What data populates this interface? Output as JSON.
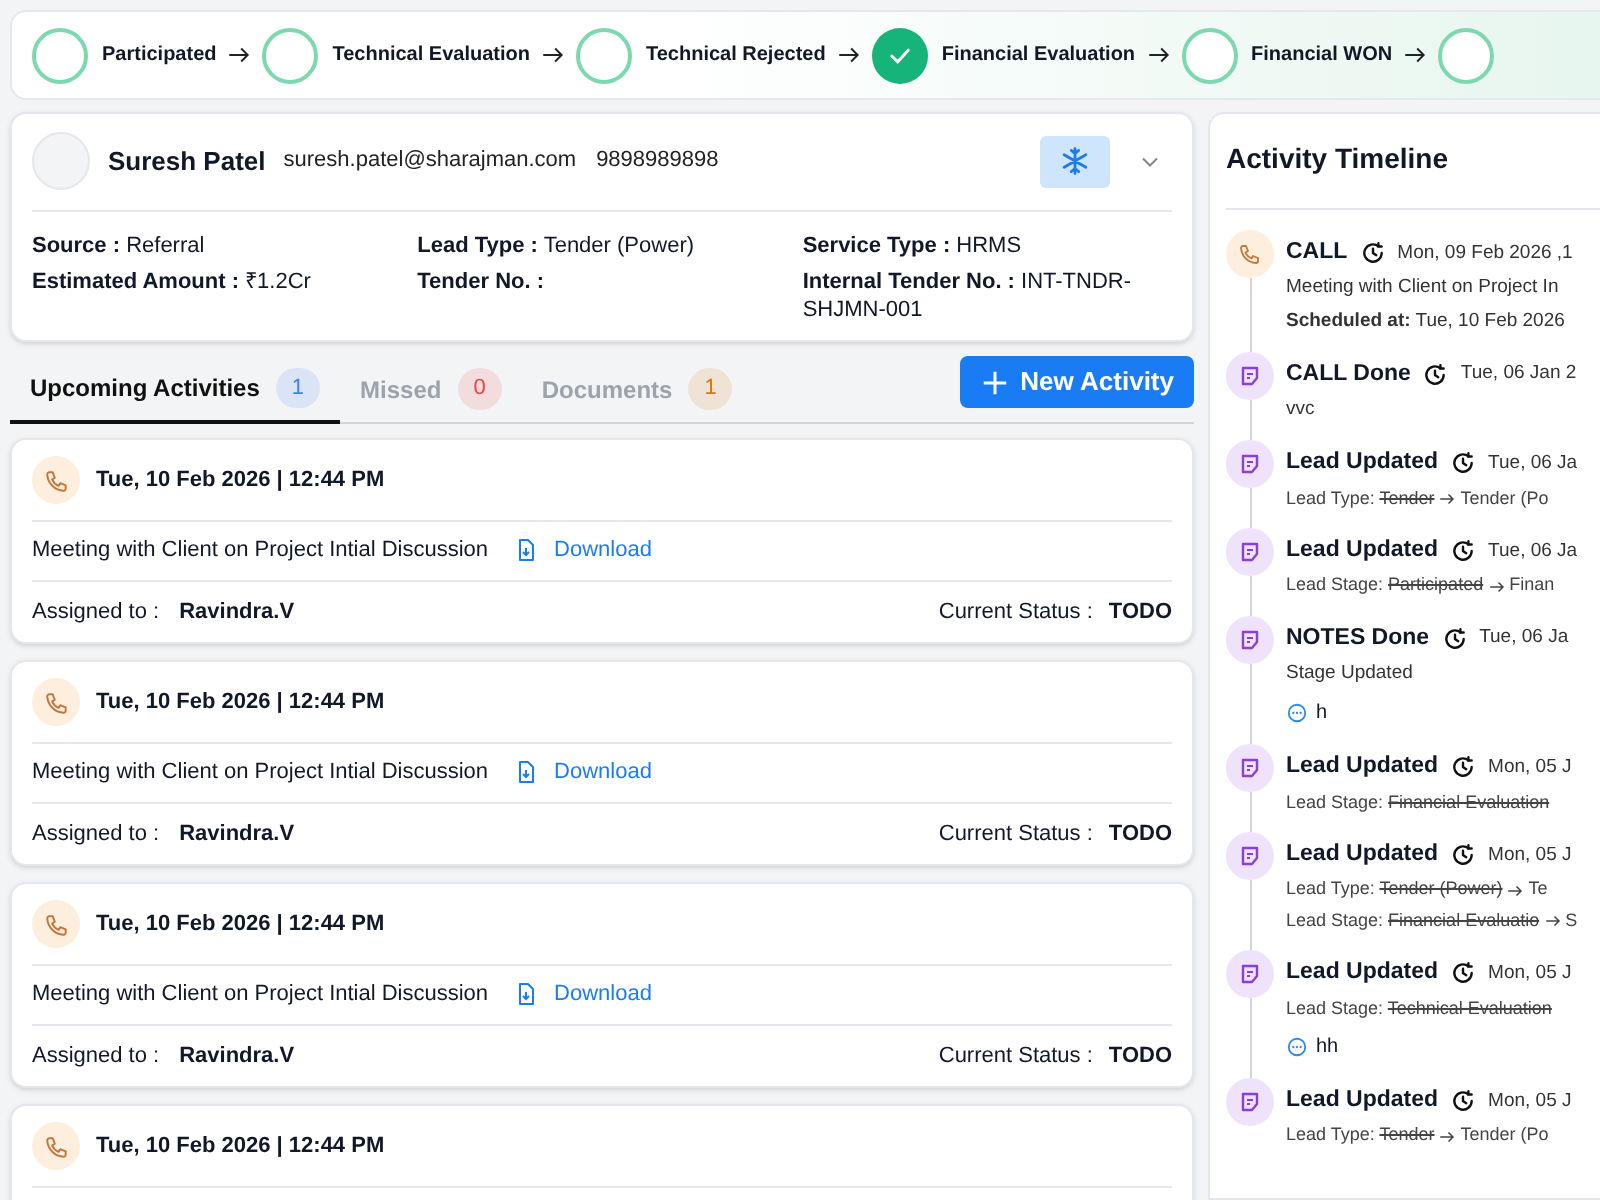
{
  "stages": [
    {
      "label": "Participated",
      "completed": false
    },
    {
      "label": "Technical Evaluation",
      "completed": false
    },
    {
      "label": "Technical Rejected",
      "completed": false
    },
    {
      "label": "Financial Evaluation",
      "completed": true
    },
    {
      "label": "Financial WON",
      "completed": false
    },
    {
      "completed": false
    }
  ],
  "lead": {
    "name": "Suresh Patel",
    "email": "suresh.patel@sharajman.com",
    "phone": "9898989898",
    "fields": [
      [
        {
          "label": "Source :",
          "value": "Referral"
        },
        {
          "label": "Estimated Amount :",
          "value": "₹1.2Cr"
        }
      ],
      [
        {
          "label": "Lead Type :",
          "value": "Tender (Power)"
        },
        {
          "label": "Tender No. :"
        }
      ],
      [
        {
          "label": "Service Type :",
          "value": "HRMS"
        },
        {
          "label": "Internal Tender No. :",
          "value": "INT-TNDR-SHJMN-001"
        }
      ]
    ]
  },
  "tabs": [
    {
      "label": "Upcoming Activities",
      "count": "1",
      "selected": true,
      "color": "#3b82f6"
    },
    {
      "label": "Missed",
      "count": "0",
      "selected": false,
      "color": "#ef4444"
    },
    {
      "label": "Documents",
      "count": "1",
      "selected": false,
      "color": "#d97706"
    }
  ],
  "new_activity_button": "New Activity",
  "activities": [
    {
      "datetime": "Tue, 10 Feb 2026 | 12:44 PM",
      "description": "Meeting with Client on Project Intial Discussion",
      "link": "Download",
      "assigned_label": "Assigned to :",
      "assigned": "Ravindra.V",
      "status_label": "Current Status :",
      "status": "TODO"
    },
    {
      "datetime": "Tue, 10 Feb 2026 | 12:44 PM",
      "description": "Meeting with Client on Project Intial Discussion",
      "link": "Download",
      "assigned_label": "Assigned to :",
      "assigned": "Ravindra.V",
      "status_label": "Current Status :",
      "status": "TODO"
    },
    {
      "datetime": "Tue, 10 Feb 2026 | 12:44 PM",
      "description": "Meeting with Client on Project Intial Discussion",
      "link": "Download",
      "assigned_label": "Assigned to :",
      "assigned": "Ravindra.V",
      "status_label": "Current Status :",
      "status": "TODO"
    },
    {
      "datetime": "Tue, 10 Feb 2026 | 12:44 PM"
    }
  ],
  "timeline": {
    "title": "Activity Timeline",
    "entries": [
      {
        "kind": "call",
        "title": "CALL",
        "time": "Mon, 09 Feb 2026 ,1",
        "lines": [
          "Meeting with Client on Project In",
          "**Scheduled at:** Tue, 10 Feb 2026"
        ]
      },
      {
        "kind": "note",
        "title": "CALL Done",
        "time": "Tue, 06 Jan 2",
        "lines": [
          "vvc"
        ]
      },
      {
        "kind": "note",
        "title": "Lead Updated",
        "time": "Tue, 06 Ja",
        "changes": [
          {
            "label": "Lead Type:",
            "old": "Tender",
            "new": "Tender (Po"
          }
        ]
      },
      {
        "kind": "note",
        "title": "Lead Updated",
        "time": "Tue, 06 Ja",
        "changes": [
          {
            "label": "Lead Stage:",
            "old": "Participated",
            "new": "Finan"
          }
        ]
      },
      {
        "kind": "note",
        "title": "NOTES Done",
        "time": "Tue, 06 Ja",
        "lines": [
          "Stage Updated"
        ],
        "comment": "h"
      },
      {
        "kind": "note",
        "title": "Lead Updated",
        "time": "Mon, 05 J",
        "changes": [
          {
            "label": "Lead Stage:",
            "old": "Financial Evaluation"
          }
        ]
      },
      {
        "kind": "note",
        "title": "Lead Updated",
        "time": "Mon, 05 J",
        "changes": [
          {
            "label": "Lead Type:",
            "old": "Tender (Power)",
            "new": "Te"
          },
          {
            "label": "Lead Stage:",
            "old": "Financial Evaluatio",
            "new": "S"
          }
        ]
      },
      {
        "kind": "note",
        "title": "Lead Updated",
        "time": "Mon, 05 J",
        "changes": [
          {
            "label": "Lead Stage:",
            "old": "Technical Evaluation"
          }
        ],
        "comment": "hh"
      },
      {
        "kind": "note",
        "title": "Lead Updated",
        "time": "Mon, 05 J",
        "changes": [
          {
            "label": "Lead Type:",
            "old": "Tender",
            "new": "Tender (Po"
          }
        ]
      }
    ]
  }
}
